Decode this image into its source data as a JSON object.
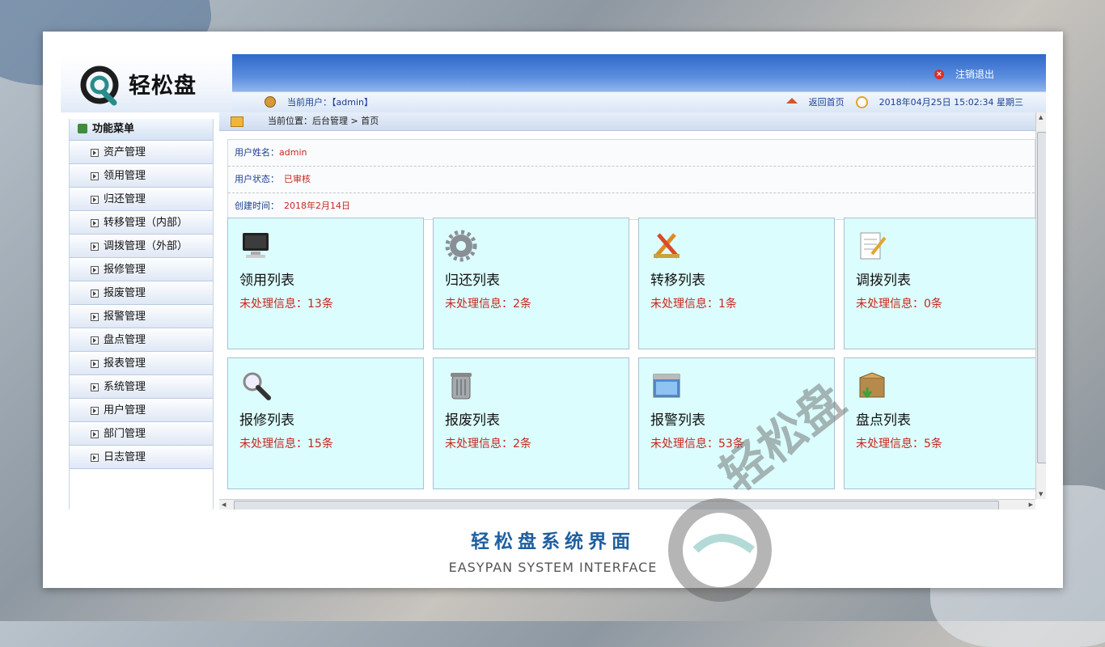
{
  "app": {
    "brand": "轻松盘"
  },
  "header": {
    "logout_label": "注销退出",
    "current_user": "当前用户：【admin】",
    "home_link": "返回首页",
    "datetime": "2018年04月25日 15:02:34 星期三"
  },
  "sidebar": {
    "title": "功能菜单",
    "items": [
      "资产管理",
      "领用管理",
      "归还管理",
      "转移管理（内部）",
      "调拨管理（外部）",
      "报修管理",
      "报废管理",
      "报警管理",
      "盘点管理",
      "报表管理",
      "系统管理",
      "用户管理",
      "部门管理",
      "日志管理"
    ]
  },
  "location": "当前位置：后台管理 > 首页",
  "user_info": {
    "name_label": "用户姓名：",
    "name_value": "admin",
    "status_label": "用户状态：",
    "status_value": "已审核",
    "created_label": "创建时间：",
    "created_value": "2018年2月14日"
  },
  "tiles": [
    {
      "name": "领用列表",
      "count": "未处理信息：13条",
      "icon": "monitor-icon"
    },
    {
      "name": "归还列表",
      "count": "未处理信息：2条",
      "icon": "gear-icon"
    },
    {
      "name": "转移列表",
      "count": "未处理信息：1条",
      "icon": "tools-icon"
    },
    {
      "name": "调拨列表",
      "count": "未处理信息：0条",
      "icon": "notepad-icon"
    },
    {
      "name": "报修列表",
      "count": "未处理信息：15条",
      "icon": "magnifier-icon"
    },
    {
      "name": "报废列表",
      "count": "未处理信息：2条",
      "icon": "trash-icon"
    },
    {
      "name": "报警列表",
      "count": "未处理信息：53条",
      "icon": "window-icon"
    },
    {
      "name": "盘点列表",
      "count": "未处理信息：5条",
      "icon": "box-icon"
    }
  ],
  "caption": {
    "cn": "轻松盘系统界面",
    "en": "EASYPAN SYSTEM INTERFACE"
  },
  "watermark": "轻松盘"
}
